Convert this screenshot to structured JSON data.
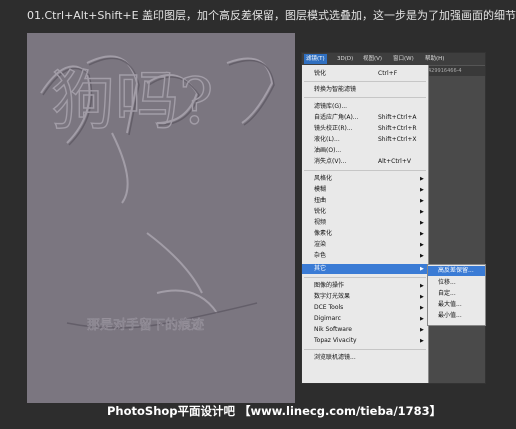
{
  "instruction": "01.Ctrl+Alt+Shift+E 盖印图层，加个高反差保留，图层模式选叠加，这一步是为了加强画面的细节。",
  "menubar": {
    "items": [
      {
        "label": "滤镜(T)",
        "active": true
      },
      {
        "label": "3D(D)"
      },
      {
        "label": "视图(V)"
      },
      {
        "label": "窗口(W)"
      },
      {
        "label": "帮助(H)"
      }
    ]
  },
  "document_tab": "429916466-4",
  "filter_menu": {
    "items": [
      {
        "label": "锐化",
        "shortcut": "Ctrl+F"
      },
      {
        "label": "转换为智能滤镜"
      },
      {
        "label": "滤镜库(G)..."
      },
      {
        "label": "自适应广角(A)...",
        "shortcut": "Shift+Ctrl+A"
      },
      {
        "label": "镜头校正(R)...",
        "shortcut": "Shift+Ctrl+R"
      },
      {
        "label": "液化(L)...",
        "shortcut": "Shift+Ctrl+X"
      },
      {
        "label": "油画(O)..."
      },
      {
        "label": "消失点(V)...",
        "shortcut": "Alt+Ctrl+V"
      },
      {
        "label": "风格化",
        "submenu": true
      },
      {
        "label": "模糊",
        "submenu": true
      },
      {
        "label": "扭曲",
        "submenu": true
      },
      {
        "label": "锐化",
        "submenu": true
      },
      {
        "label": "视频",
        "submenu": true
      },
      {
        "label": "像素化",
        "submenu": true
      },
      {
        "label": "渲染",
        "submenu": true
      },
      {
        "label": "杂色",
        "submenu": true
      },
      {
        "label": "其它",
        "submenu": true,
        "highlighted": true
      },
      {
        "label": "图像的操作",
        "submenu": true
      },
      {
        "label": "数字灯光效果",
        "submenu": true
      },
      {
        "label": "DCE Tools",
        "submenu": true
      },
      {
        "label": "Digimarc",
        "submenu": true
      },
      {
        "label": "Nik Software",
        "submenu": true
      },
      {
        "label": "Topaz Vivacity",
        "submenu": true
      },
      {
        "label": "浏览联机滤镜..."
      }
    ]
  },
  "other_submenu": {
    "items": [
      {
        "label": "高反差保留...",
        "highlighted": true
      },
      {
        "label": "位移..."
      },
      {
        "label": "自定..."
      },
      {
        "label": "最大值..."
      },
      {
        "label": "最小值..."
      }
    ]
  },
  "canvas": {
    "headline": "狗吗?",
    "slogan": "那是对手留下的痕迹"
  },
  "footer": "PhotoShop平面设计吧 【www.linecg.com/tieba/1783】",
  "colors": {
    "background": "#2d2d2d",
    "canvas": "#7b7680",
    "menu_highlight": "#3a7bd5"
  }
}
